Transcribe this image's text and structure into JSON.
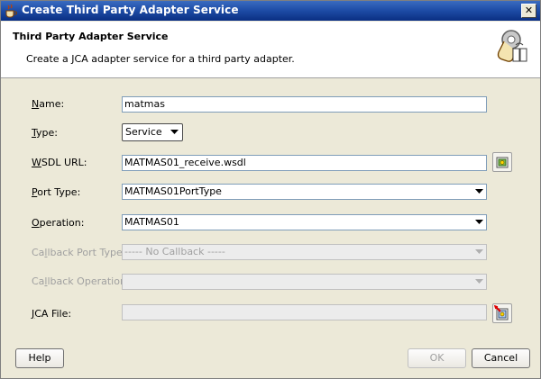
{
  "window": {
    "title": "Create Third Party Adapter Service",
    "close_glyph": "✕"
  },
  "header": {
    "title": "Third Party Adapter Service",
    "description": "Create a JCA adapter service for a third party adapter.",
    "icon": "adapter-gear-icon"
  },
  "form": {
    "name": {
      "label_u": "N",
      "label_rest": "ame:",
      "value": "matmas"
    },
    "type": {
      "label_u": "T",
      "label_rest": "ype:",
      "value": "Service"
    },
    "wsdl_url": {
      "label_u": "W",
      "label_rest": "SDL URL:",
      "value": "MATMAS01_receive.wsdl"
    },
    "port_type": {
      "label_u": "P",
      "label_rest": "ort Type:",
      "value": "MATMAS01PortType"
    },
    "operation": {
      "label_u": "O",
      "label_rest": "peration:",
      "value": "MATMAS01"
    },
    "callback_port_type": {
      "label_pre": "Ca",
      "label_u": "l",
      "label_rest": "lback Port Type:",
      "value": "----- No Callback -----"
    },
    "callback_operation": {
      "label_pre": "Ca",
      "label_u": "l",
      "label_rest": "lback Operation:",
      "value": ""
    },
    "jca_file": {
      "label_u": "J",
      "label_rest": "CA File:",
      "value": ""
    }
  },
  "buttons": {
    "help": "Help",
    "ok": "OK",
    "cancel": "Cancel"
  }
}
